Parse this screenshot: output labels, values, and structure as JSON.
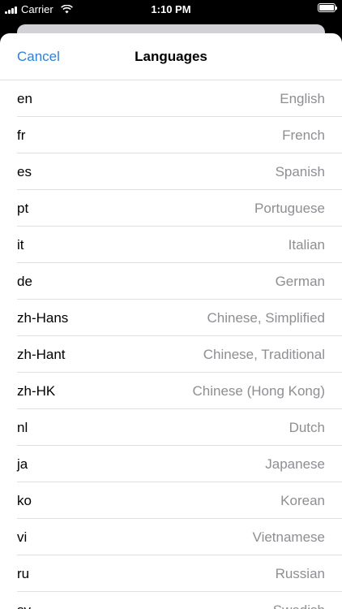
{
  "status_bar": {
    "carrier": "Carrier",
    "time": "1:10 PM",
    "icons": [
      "signal-icon",
      "wifi-icon",
      "battery-icon"
    ]
  },
  "nav": {
    "cancel_label": "Cancel",
    "title": "Languages"
  },
  "colors": {
    "accent": "#2f7fd6",
    "secondary_text": "#8e8e93",
    "separator": "#e0e0e0"
  },
  "languages": [
    {
      "code": "en",
      "name": "English"
    },
    {
      "code": "fr",
      "name": "French"
    },
    {
      "code": "es",
      "name": "Spanish"
    },
    {
      "code": "pt",
      "name": "Portuguese"
    },
    {
      "code": "it",
      "name": "Italian"
    },
    {
      "code": "de",
      "name": "German"
    },
    {
      "code": "zh-Hans",
      "name": "Chinese, Simplified"
    },
    {
      "code": "zh-Hant",
      "name": "Chinese, Traditional"
    },
    {
      "code": "zh-HK",
      "name": "Chinese (Hong Kong)"
    },
    {
      "code": "nl",
      "name": "Dutch"
    },
    {
      "code": "ja",
      "name": "Japanese"
    },
    {
      "code": "ko",
      "name": "Korean"
    },
    {
      "code": "vi",
      "name": "Vietnamese"
    },
    {
      "code": "ru",
      "name": "Russian"
    },
    {
      "code": "sv",
      "name": "Swedish"
    }
  ]
}
